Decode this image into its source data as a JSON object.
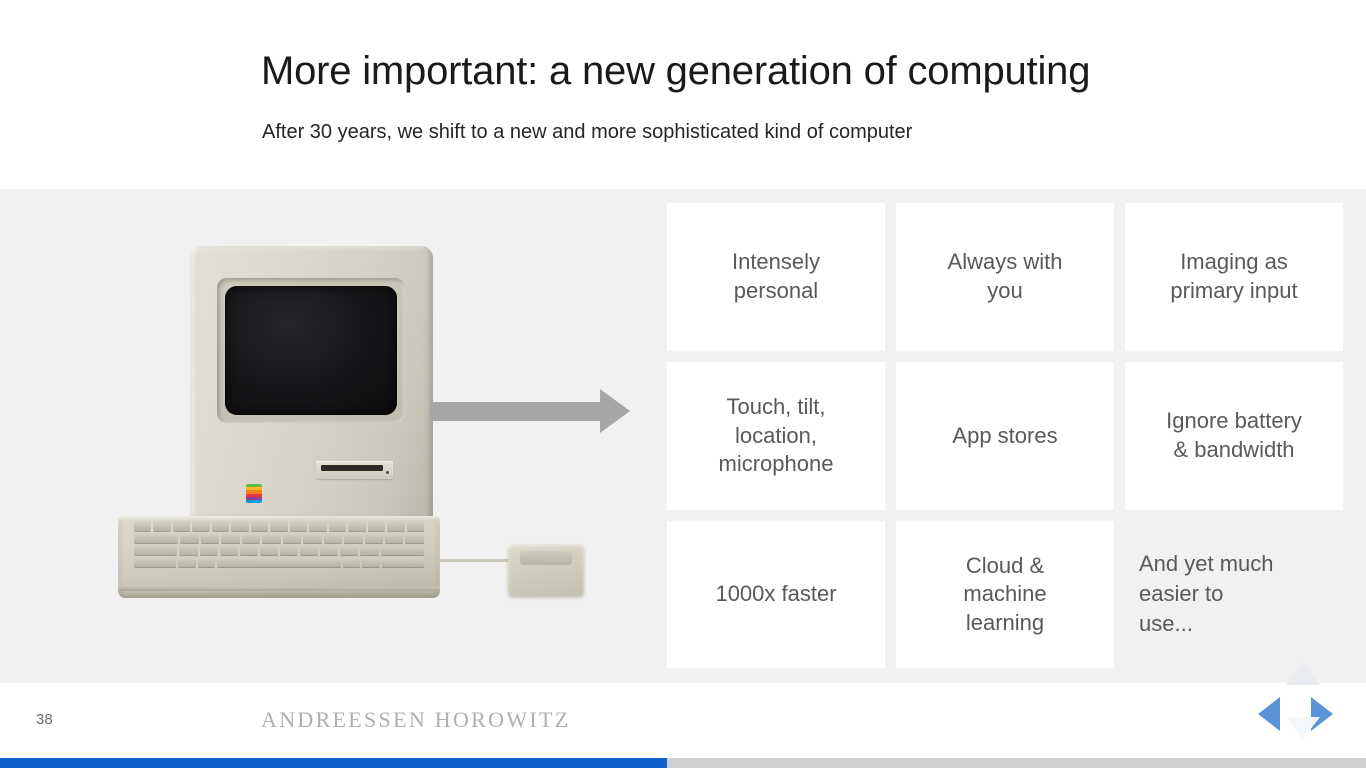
{
  "header": {
    "title": "More important: a new generation of computing",
    "subtitle": "After 30 years, we shift to a new and more sophisticated kind of computer"
  },
  "figure": {
    "device_name": "macintosh-128k",
    "arrow_name": "transition-arrow",
    "arrow_color": "#a6a6a6"
  },
  "grid": {
    "cells": [
      {
        "label": "Intensely\npersonal",
        "style": "card"
      },
      {
        "label": "Always with\nyou",
        "style": "card"
      },
      {
        "label": "Imaging as\nprimary input",
        "style": "card"
      },
      {
        "label": "Touch, tilt,\nlocation,\nmicrophone",
        "style": "card"
      },
      {
        "label": "App stores",
        "style": "card"
      },
      {
        "label": "Ignore battery\n& bandwidth",
        "style": "card"
      },
      {
        "label": "1000x faster",
        "style": "card"
      },
      {
        "label": "Cloud &\nmachine\nlearning",
        "style": "card"
      },
      {
        "label": "And yet much\neasier to\nuse...",
        "style": "plain"
      }
    ]
  },
  "footer": {
    "page_number": "38",
    "wordmark": "ANDREESSEN HOROWITZ"
  },
  "navigation": {
    "left_label": "Previous slide",
    "right_label": "Next slide",
    "up_label": "Up",
    "down_label": "Down",
    "active_color": "#5b94d6",
    "disabled_color": "#e8ebef"
  },
  "progress": {
    "percent": 48.8,
    "fill_color": "#0f62cb",
    "track_color": "#d0d0d0"
  },
  "colors": {
    "band_background": "#f1f1f1",
    "card_background": "#ffffff",
    "card_text": "#595959",
    "title_text": "#1a1a1a"
  }
}
